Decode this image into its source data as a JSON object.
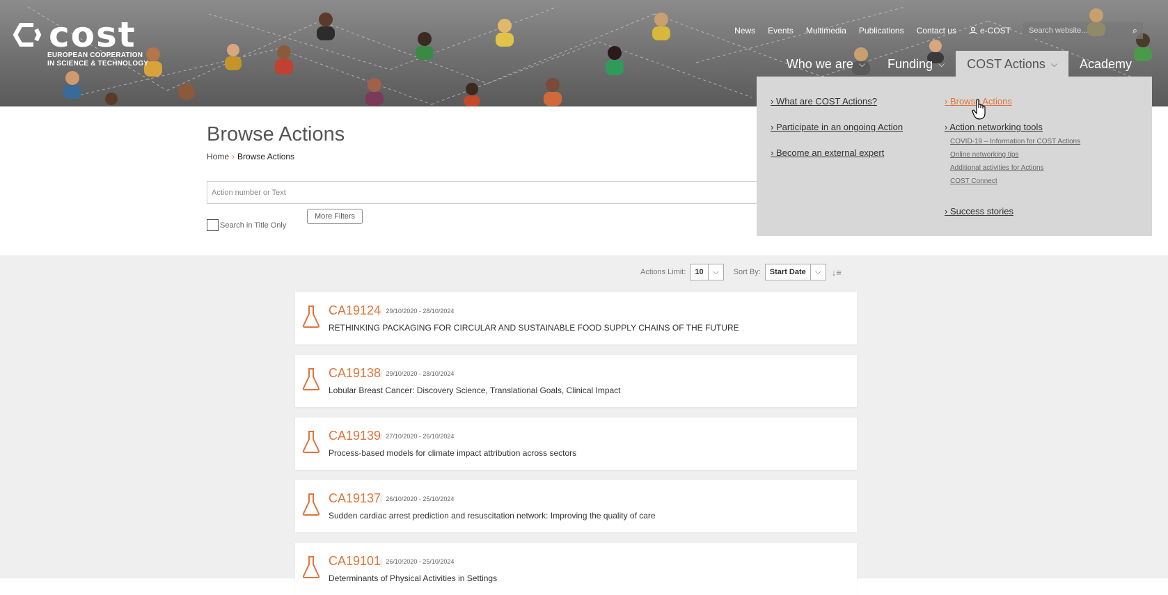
{
  "brand": {
    "logo_word": "cost",
    "logo_sub_line1": "EUROPEAN COOPERATION",
    "logo_sub_line2": "IN SCIENCE & TECHNOLOGY"
  },
  "topnav": {
    "items": [
      "News",
      "Events",
      "Multimedia",
      "Publications",
      "Contact us"
    ],
    "ecost": "e-COST",
    "search_placeholder": "Search website..."
  },
  "mainnav": {
    "items": [
      {
        "label": "Who we are"
      },
      {
        "label": "Funding"
      },
      {
        "label": "COST Actions"
      },
      {
        "label": "Academy"
      }
    ]
  },
  "dropdown": {
    "left": [
      "What are COST Actions?",
      "Participate in an ongoing Action",
      "Become an external expert"
    ],
    "right_browse": "Browse Actions",
    "right_tools": "Action networking tools",
    "tools_sub": [
      "COVID-19 – Information for COST Actions",
      "Online networking tips",
      "Additional activities for Actions",
      "COST Connect"
    ],
    "right_success": "Success stories"
  },
  "page": {
    "title": "Browse Actions",
    "breadcrumb_home": "Home",
    "breadcrumb_current": "Browse Actions",
    "search_placeholder": "Action number or Text",
    "title_only_label": "Search in Title Only",
    "more_filters_label": "More Filters"
  },
  "controls": {
    "limit_label": "Actions Limit:",
    "limit_value": "10",
    "sort_label": "Sort By:",
    "sort_value": "Start Date"
  },
  "actions": [
    {
      "code": "CA19124",
      "dates": "29/10/2020 - 28/10/2024",
      "title": "RETHINKING PACKAGING FOR CIRCULAR AND SUSTAINABLE FOOD SUPPLY CHAINS OF THE FUTURE"
    },
    {
      "code": "CA19138",
      "dates": "29/10/2020 - 28/10/2024",
      "title": "Lobular Breast Cancer: Discovery Science, Translational Goals, Clinical Impact"
    },
    {
      "code": "CA19139",
      "dates": "27/10/2020 - 26/10/2024",
      "title": "Process-based models for climate impact attribution across sectors"
    },
    {
      "code": "CA19137",
      "dates": "26/10/2020 - 25/10/2024",
      "title": "Sudden cardiac arrest prediction and resuscitation network: Improving the quality of care"
    },
    {
      "code": "CA19101",
      "dates": "26/10/2020 - 25/10/2024",
      "title": "Determinants of Physical Activities in Settings"
    }
  ],
  "colors": {
    "accent": "#e0743a",
    "dropdown_bg": "#d7d7d7",
    "results_bg": "#efefef"
  }
}
